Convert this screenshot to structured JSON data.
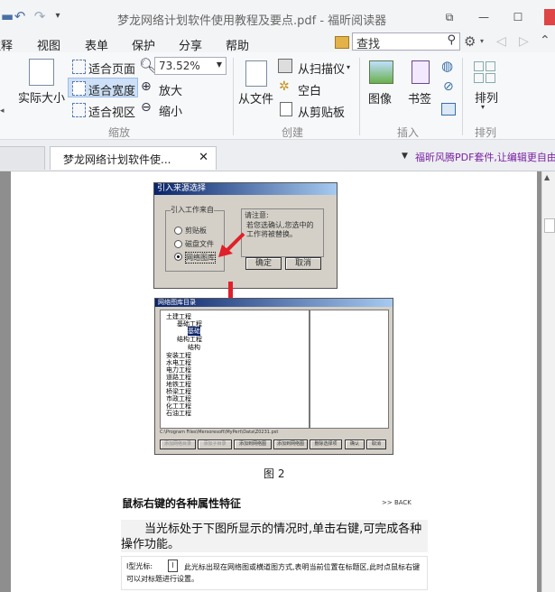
{
  "window": {
    "title": "梦龙网络计划软件使用教程及要点.pdf - 福昕阅读器",
    "controls": [
      "⧉",
      "—",
      "☐"
    ]
  },
  "menu": {
    "items": [
      "注释",
      "视图",
      "表单",
      "保护",
      "分享",
      "帮助"
    ],
    "search_placeholder": "查找"
  },
  "ribbon": {
    "actual_size": "实际大小",
    "fit_page": "适合页面",
    "fit_width": "适合宽度",
    "fit_view": "适合视区",
    "zoom_value": "73.52%",
    "zoom_in": "放大",
    "zoom_out": "缩小",
    "group_zoom": "缩放",
    "from_file": "从文件",
    "from_scanner": "从扫描仪",
    "blank": "空白",
    "from_clipboard": "从剪贴板",
    "group_create": "创建",
    "image": "图像",
    "bookmark": "书签",
    "group_insert": "插入",
    "arrange": "排列",
    "group_arrange": "排列"
  },
  "tabs": {
    "doc_tab": "梦龙网络计划软件使...",
    "ad_text": "福昕风腾PDF套件,让编辑更自由"
  },
  "document": {
    "dialog1": {
      "title": "引入来源选择",
      "group_label": "引入工作来自",
      "options": [
        "剪贴板",
        "磁盘文件",
        "网络图库"
      ],
      "note_title": "请注意:",
      "note_body": "若您选确认,您选中的工作将被替换。",
      "ok": "确定",
      "cancel": "取消"
    },
    "dialog2": {
      "title": "网络图库目录",
      "tree": [
        "土建工程",
        "基础工程",
        "基础",
        "结构工程",
        "结构",
        "安装工程",
        "水电工程",
        "电力工程",
        "道路工程",
        "地铁工程",
        "桥梁工程",
        "市政工程",
        "化工工程",
        "石油工程"
      ],
      "path": "C:\\Program Files\\Mersoresoft\\MyPert\\Data\\Z0231.pst",
      "buttons": [
        "添加网络目录",
        "添加子目录",
        "添加到网络图",
        "添加到网络图",
        "删除选择项",
        "确认",
        "取消"
      ]
    },
    "figure_caption": "图 2",
    "heading": "鼠标右键的各种属性特征",
    "back_link": ">> BACK",
    "paragraph": "当光标处于下图所显示的情况时,单击右键,可完成各种操作功能。",
    "note_prefix": "I型光标:",
    "note_text": "此光标出现在网络图或横道图方式,表明当前位置在标题区,此时点鼠标右键可以对标题进行设置。"
  },
  "colors": {
    "accent": "#0a246a",
    "arrow": "#e0202a",
    "ad": "#7a1fa2"
  }
}
